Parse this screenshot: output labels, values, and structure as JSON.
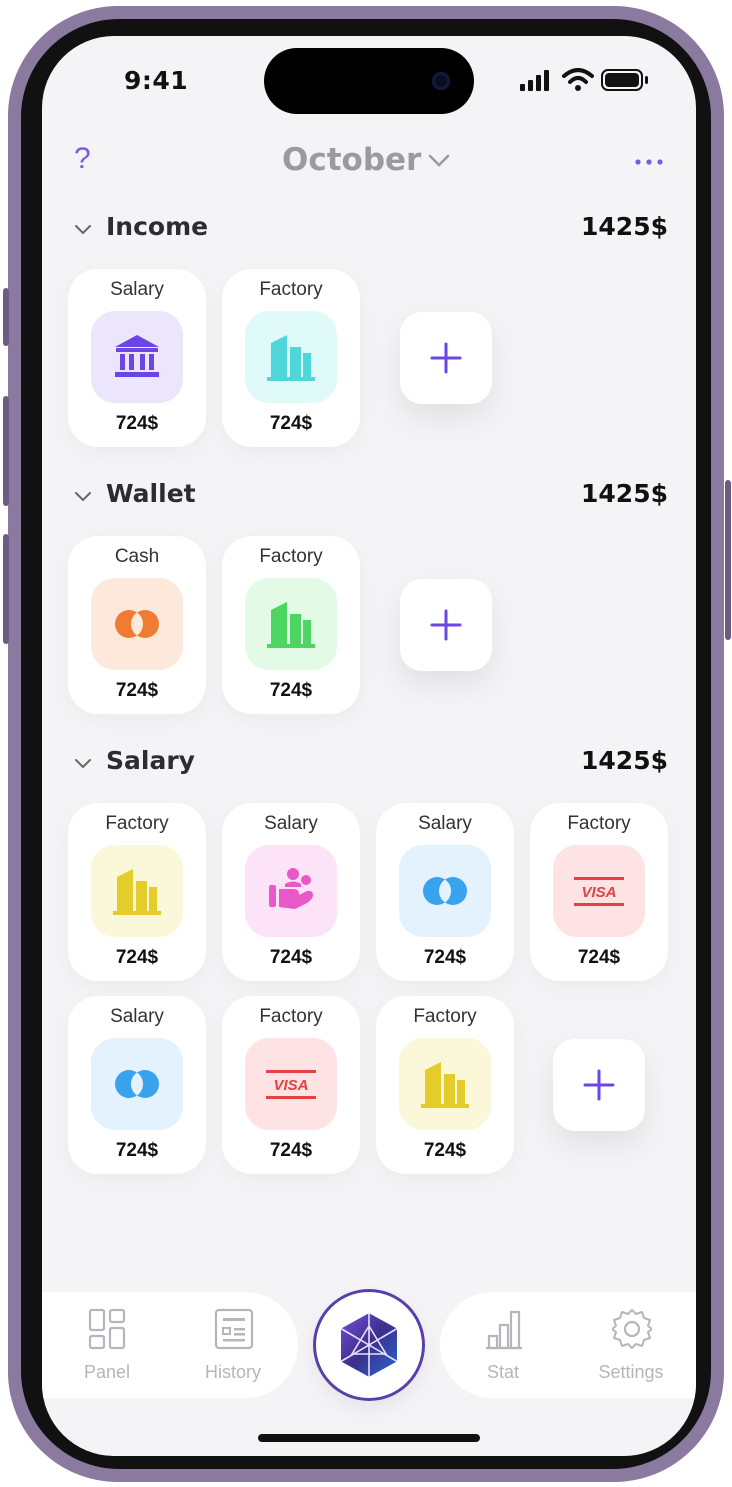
{
  "status_bar": {
    "time": "9:41"
  },
  "header": {
    "month": "October",
    "help_symbol": "?"
  },
  "sections": [
    {
      "title": "Income",
      "total": "1425$",
      "cards": [
        {
          "label": "Salary",
          "amount": "724$",
          "icon": "bank-icon",
          "color": "#6b45e6",
          "tile": "#ece6fd"
        },
        {
          "label": "Factory",
          "amount": "724$",
          "icon": "factory-icon",
          "color": "#4fd6d9",
          "tile": "#e0fafa"
        }
      ]
    },
    {
      "title": "Wallet",
      "total": "1425$",
      "cards": [
        {
          "label": "Cash",
          "amount": "724$",
          "icon": "mastercard-icon",
          "color": "#ef7c32",
          "tile": "#fde9dc"
        },
        {
          "label": "Factory",
          "amount": "724$",
          "icon": "factory-icon",
          "color": "#4cd561",
          "tile": "#e3fbe6"
        }
      ]
    },
    {
      "title": "Salary",
      "total": "1425$",
      "cards": [
        {
          "label": "Factory",
          "amount": "724$",
          "icon": "factory-icon",
          "color": "#e4cc2a",
          "tile": "#fbf8d9"
        },
        {
          "label": "Salary",
          "amount": "724$",
          "icon": "family-icon",
          "color": "#e858c7",
          "tile": "#fce3f7"
        },
        {
          "label": "Salary",
          "amount": "724$",
          "icon": "mastercard-icon",
          "color": "#3aa3ee",
          "tile": "#e3f2fd"
        },
        {
          "label": "Factory",
          "amount": "724$",
          "icon": "visa-icon",
          "color": "#e64040",
          "tile": "#fde3e3"
        },
        {
          "label": "Salary",
          "amount": "724$",
          "icon": "mastercard-icon",
          "color": "#3aa3ee",
          "tile": "#e3f2fd"
        },
        {
          "label": "Factory",
          "amount": "724$",
          "icon": "visa-icon",
          "color": "#e64040",
          "tile": "#fde3e3"
        },
        {
          "label": "Factory",
          "amount": "724$",
          "icon": "factory-icon",
          "color": "#e4cc2a",
          "tile": "#fbf8d9"
        }
      ]
    }
  ],
  "visa_text": "VISA",
  "tab_bar": {
    "tabs": [
      {
        "label": "Panel",
        "icon": "panel-icon"
      },
      {
        "label": "History",
        "icon": "history-icon"
      },
      {
        "label": "Stat",
        "icon": "stat-icon"
      },
      {
        "label": "Settings",
        "icon": "settings-icon"
      }
    ],
    "center_icon": "polyhedron-logo-icon"
  },
  "colors": {
    "accent": "#6b45e6",
    "background": "#f4f4f6",
    "tab_inactive": "#b5b5bb"
  }
}
